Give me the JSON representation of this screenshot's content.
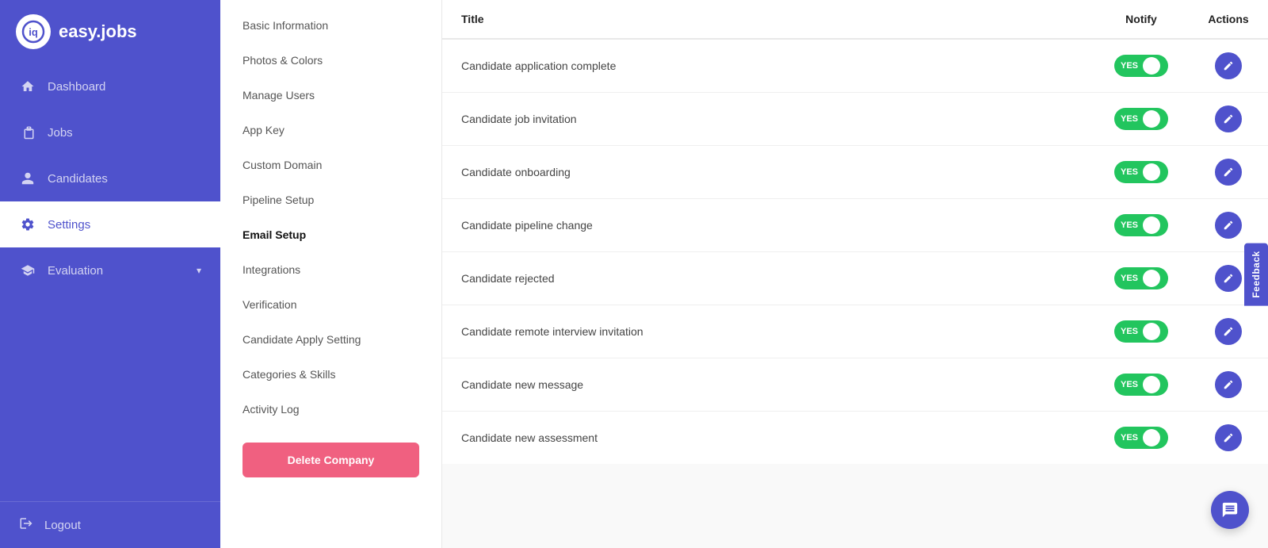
{
  "app": {
    "logo_text": "easy.jobs",
    "logo_icon": "iq"
  },
  "sidebar": {
    "items": [
      {
        "id": "dashboard",
        "label": "Dashboard",
        "icon": "home"
      },
      {
        "id": "jobs",
        "label": "Jobs",
        "icon": "briefcase"
      },
      {
        "id": "candidates",
        "label": "Candidates",
        "icon": "person"
      },
      {
        "id": "settings",
        "label": "Settings",
        "icon": "gear",
        "active": true
      },
      {
        "id": "evaluation",
        "label": "Evaluation",
        "icon": "graduation",
        "has_chevron": true
      }
    ],
    "logout_label": "Logout"
  },
  "settings_nav": {
    "items": [
      {
        "id": "basic-information",
        "label": "Basic Information",
        "active": false
      },
      {
        "id": "photos-colors",
        "label": "Photos & Colors",
        "active": false
      },
      {
        "id": "manage-users",
        "label": "Manage Users",
        "active": false
      },
      {
        "id": "app-key",
        "label": "App Key",
        "active": false
      },
      {
        "id": "custom-domain",
        "label": "Custom Domain",
        "active": false
      },
      {
        "id": "pipeline-setup",
        "label": "Pipeline Setup",
        "active": false
      },
      {
        "id": "email-setup",
        "label": "Email Setup",
        "active": true
      },
      {
        "id": "integrations",
        "label": "Integrations",
        "active": false
      },
      {
        "id": "verification",
        "label": "Verification",
        "active": false
      },
      {
        "id": "candidate-apply-setting",
        "label": "Candidate Apply Setting",
        "active": false
      },
      {
        "id": "categories-skills",
        "label": "Categories & Skills",
        "active": false
      },
      {
        "id": "activity-log",
        "label": "Activity Log",
        "active": false
      }
    ],
    "delete_btn_label": "Delete Company"
  },
  "email_table": {
    "col_title": "Title",
    "col_notify": "Notify",
    "col_actions": "Actions",
    "rows": [
      {
        "id": 1,
        "title": "Candidate application complete",
        "notify": true
      },
      {
        "id": 2,
        "title": "Candidate job invitation",
        "notify": true
      },
      {
        "id": 3,
        "title": "Candidate onboarding",
        "notify": true
      },
      {
        "id": 4,
        "title": "Candidate pipeline change",
        "notify": true
      },
      {
        "id": 5,
        "title": "Candidate rejected",
        "notify": true
      },
      {
        "id": 6,
        "title": "Candidate remote interview invitation",
        "notify": true
      },
      {
        "id": 7,
        "title": "Candidate new message",
        "notify": true
      },
      {
        "id": 8,
        "title": "Candidate new assessment",
        "notify": true
      }
    ],
    "toggle_yes_label": "YES"
  },
  "feedback": {
    "label": "Feedback"
  },
  "chat": {
    "icon": "💬"
  },
  "colors": {
    "primary": "#4f52cc",
    "sidebar_bg": "#4f52cc",
    "toggle_active": "#22c55e",
    "delete_btn": "#f06080"
  }
}
